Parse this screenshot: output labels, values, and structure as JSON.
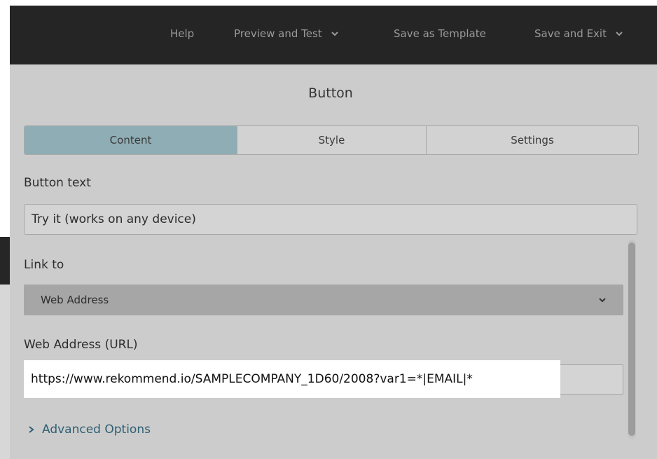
{
  "topbar": {
    "help": "Help",
    "preview_and_test": "Preview and Test",
    "save_as_template": "Save as Template",
    "save_and_exit": "Save and Exit"
  },
  "panel": {
    "title": "Button"
  },
  "tabs": [
    {
      "label": "Content",
      "active": true
    },
    {
      "label": "Style",
      "active": false
    },
    {
      "label": "Settings",
      "active": false
    }
  ],
  "form": {
    "button_text_label": "Button text",
    "button_text_value": "Try it (works on any device)",
    "link_to_label": "Link to",
    "link_to_value": "Web Address",
    "web_address_label": "Web Address (URL)",
    "web_address_value": "https://www.rekommend.io/SAMPLECOMPANY_1D60/2008?var1=*|EMAIL|*",
    "advanced_options": "Advanced Options"
  },
  "colors": {
    "topbar": "#252525",
    "panel": "#cccccc",
    "active_tab": "#8fadb5",
    "link": "#2f5f73"
  },
  "icons": {
    "preview_dropdown": "chevron-down-icon",
    "save_exit_dropdown": "chevron-down-icon",
    "link_to_dropdown": "chevron-down-icon",
    "advanced_toggle": "chevron-right-icon"
  }
}
